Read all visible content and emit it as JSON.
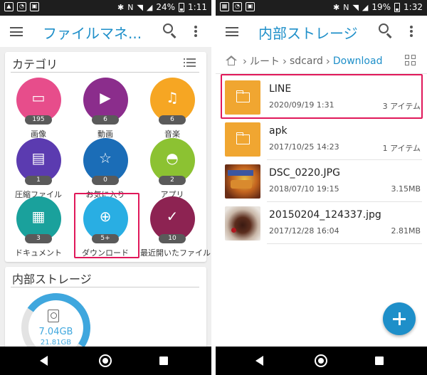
{
  "left": {
    "status": {
      "battery": "24%",
      "time": "1:11"
    },
    "app_title": "ファイルマネ...",
    "categories": {
      "title": "カテゴリ",
      "items": [
        {
          "label": "画像",
          "count": "195",
          "color": "#e74d8b",
          "icon": "image-icon"
        },
        {
          "label": "動画",
          "count": "6",
          "color": "#8b2d8c",
          "icon": "video-icon"
        },
        {
          "label": "音楽",
          "count": "6",
          "color": "#f6a623",
          "icon": "music-icon"
        },
        {
          "label": "圧縮ファイル",
          "count": "1",
          "color": "#5b3bb0",
          "icon": "archive-icon"
        },
        {
          "label": "お気に入り",
          "count": "0",
          "color": "#1b6db7",
          "icon": "star-icon"
        },
        {
          "label": "アプリ",
          "count": "2",
          "color": "#8cc232",
          "icon": "android-icon"
        },
        {
          "label": "ドキュメント",
          "count": "3",
          "color": "#1aa19c",
          "icon": "document-icon"
        },
        {
          "label": "ダウンロード",
          "count": "5+",
          "color": "#29aee3",
          "icon": "download-icon"
        },
        {
          "label": "最近開いたファイル",
          "count": "10",
          "color": "#8d2352",
          "icon": "check-icon"
        }
      ]
    },
    "storage": {
      "title": "内部ストレージ",
      "used": "7.04GB",
      "total": "21.81GB",
      "used_fraction": 0.32
    }
  },
  "right": {
    "status": {
      "battery": "19%",
      "time": "1:32"
    },
    "app_title": "内部ストレージ",
    "breadcrumb": [
      "ルート",
      "sdcard",
      "Download"
    ],
    "files": [
      {
        "name": "LINE",
        "date": "2020/09/19 1:31",
        "meta": "3 アイテム",
        "type": "folder"
      },
      {
        "name": "apk",
        "date": "2017/10/25 14:23",
        "meta": "1 アイテム",
        "type": "folder"
      },
      {
        "name": "DSC_0220.JPG",
        "date": "2018/07/10 19:15",
        "meta": "3.15MB",
        "type": "image"
      },
      {
        "name": "20150204_124337.jpg",
        "date": "2017/12/28 16:04",
        "meta": "2.81MB",
        "type": "image"
      }
    ]
  },
  "colors": {
    "accent": "#1e8fc9",
    "highlight": "#e0185a",
    "folder": "#f0a631"
  }
}
